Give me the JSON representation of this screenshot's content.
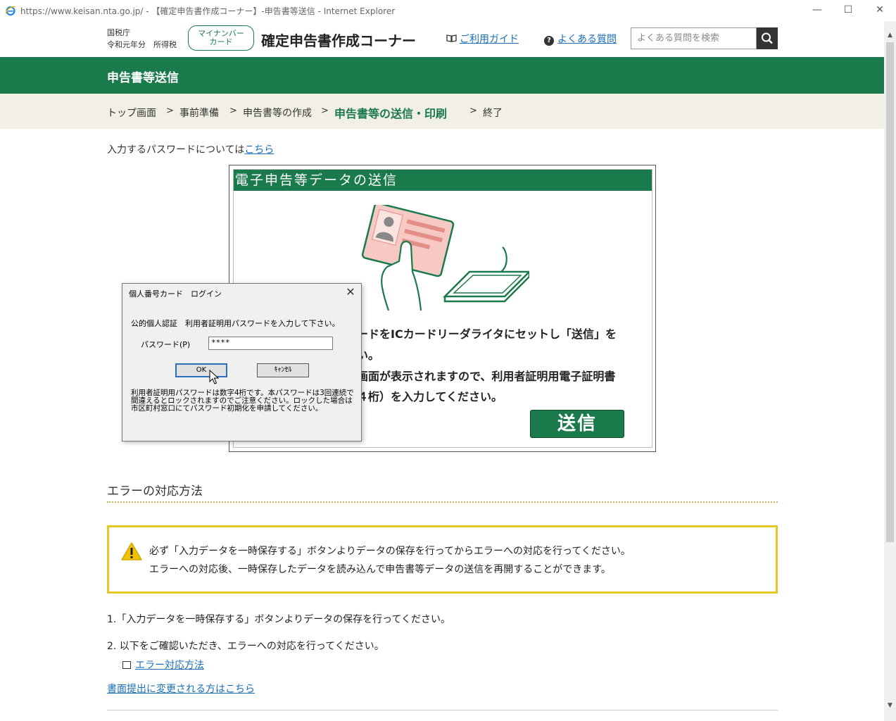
{
  "window": {
    "title": "https://www.keisan.nta.go.jp/ - 【確定申告書作成コーナー】-申告書等送信 - Internet Explorer",
    "minimize": "—",
    "maximize": "☐",
    "close": "✕"
  },
  "header": {
    "agency": "国税庁",
    "year": "令和元年分　所得税",
    "mynumber_line1": "マイナンバー",
    "mynumber_line2": "カード",
    "site_title": "確定申告書作成コーナー",
    "guide_label": "ご利用ガイド",
    "faq_label": "よくある質問",
    "search_placeholder": "よくある質問を検索"
  },
  "band": {
    "title": "申告書等送信"
  },
  "breadcrumb": {
    "items": [
      "トップ画面",
      "事前準備",
      "申告書等の作成",
      "申告書等の送信・印刷",
      "終了"
    ],
    "separator": ">"
  },
  "main": {
    "pw_note_prefix": "入力するパスワードについては",
    "pw_note_link": "こちら",
    "send_panel": {
      "heading": "電子申告等データの送信",
      "line1": "ードをICカードリーダライタにセットし「送信」を",
      "line2": "い。",
      "line3": "画面が表示されますので、利用者証明用電子証明書",
      "line4": "４桁）を入力してください。",
      "send_label": "送信"
    }
  },
  "dialog": {
    "title": "個人番号カード　ログイン",
    "close": "✕",
    "message": "公的個人認証　利用者証明用パスワードを入力して下さい。",
    "pw_label": "パスワード(P)",
    "pw_value": "****",
    "ok_label": "OK",
    "cancel_label": "ｷｬﾝｾﾙ",
    "note": "利用者証明用パスワードは数字4桁です。本パスワードは3回連続で間違えるとロックされますのでご注意ください。ロックした場合は市区町村窓口にてパスワード初期化を申請してください。"
  },
  "errors": {
    "title": "エラーの対応方法",
    "warn_line1": "必ず「入力データを一時保存する」ボタンよりデータの保存を行ってからエラーへの対応を行ってください。",
    "warn_line2": "エラーへの対応後、一時保存したデータを読み込んで申告書等データの送信を再開することができます。",
    "step1": "1.「入力データを一時保存する」ボタンよりデータの保存を行ってください。",
    "step2": "2. 以下をご確認いただき、エラーへの対応を行ってください。",
    "error_link": "エラー対応方法",
    "paper_link": "書面提出に変更される方はこちら"
  },
  "colors": {
    "brand_green": "#1a7a4c",
    "warn_yellow": "#e5c823",
    "link_blue": "#1a6eb5",
    "breadcrumb_bg": "#f2efe4"
  }
}
